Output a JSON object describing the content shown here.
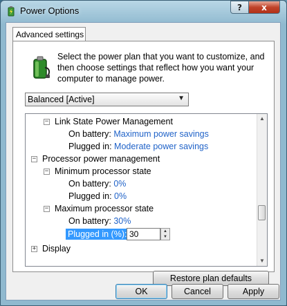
{
  "window": {
    "title": "Power Options",
    "help_label": "?",
    "close_label": "x"
  },
  "tab": {
    "label": "Advanced settings"
  },
  "description": "Select the power plan that you want to customize, and then choose settings that reflect how you want your computer to manage power.",
  "plan_select": {
    "value": "Balanced [Active]"
  },
  "tree": {
    "link_state": {
      "label": "Link State Power Management",
      "on_battery_label": "On battery:",
      "on_battery_value": "Maximum power savings",
      "plugged_in_label": "Plugged in:",
      "plugged_in_value": "Moderate power savings"
    },
    "processor": {
      "label": "Processor power management"
    },
    "min_state": {
      "label": "Minimum processor state",
      "on_battery_label": "On battery:",
      "on_battery_value": "0%",
      "plugged_in_label": "Plugged in:",
      "plugged_in_value": "0%"
    },
    "max_state": {
      "label": "Maximum processor state",
      "on_battery_label": "On battery:",
      "on_battery_value": "30%",
      "plugged_in_label": "Plugged in (%):",
      "plugged_in_value": "30"
    },
    "display": {
      "label": "Display"
    },
    "expanded_symbol": "−",
    "collapsed_symbol": "+"
  },
  "buttons": {
    "restore": "Restore plan defaults",
    "ok": "OK",
    "cancel": "Cancel",
    "apply": "Apply"
  },
  "colors": {
    "link": "#1f62c8",
    "selection": "#3399ff"
  }
}
